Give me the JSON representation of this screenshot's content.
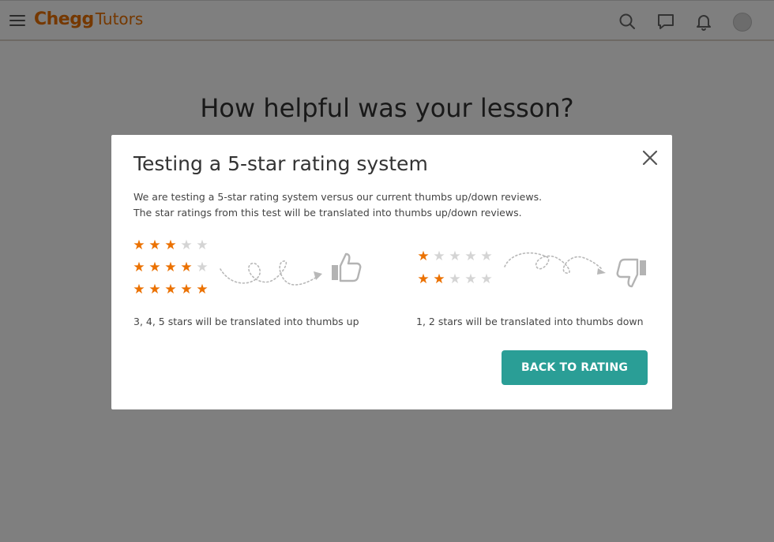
{
  "header": {
    "menu_icon": "hamburger-menu-icon",
    "logo_brand": "Chegg",
    "logo_product": "Tutors",
    "brand_color": "#eb7100",
    "icons": [
      "search-icon",
      "chat-icon",
      "bell-icon",
      "avatar"
    ]
  },
  "page": {
    "title": "How helpful was your lesson?"
  },
  "modal": {
    "title": "Testing a 5-star rating system",
    "description_lines": [
      "We are testing a 5-star rating system versus our current thumbs up/down reviews.",
      "The star ratings from this test will be translated into thumbs up/down reviews."
    ],
    "thumbs_up_group": {
      "ratings": [
        3,
        4,
        5
      ],
      "max_stars": 5,
      "icon": "thumbs-up-icon",
      "caption": "3, 4, 5 stars will be translated into thumbs up"
    },
    "thumbs_down_group": {
      "ratings": [
        1,
        2
      ],
      "max_stars": 5,
      "icon": "thumbs-down-icon",
      "caption": "1, 2 stars will be translated into thumbs down"
    },
    "back_button_label": "BACK TO RATING",
    "button_color": "#2a9e96",
    "star_on_color": "#eb7100",
    "star_off_color": "#d4d4d4",
    "close_icon": "close-icon"
  }
}
